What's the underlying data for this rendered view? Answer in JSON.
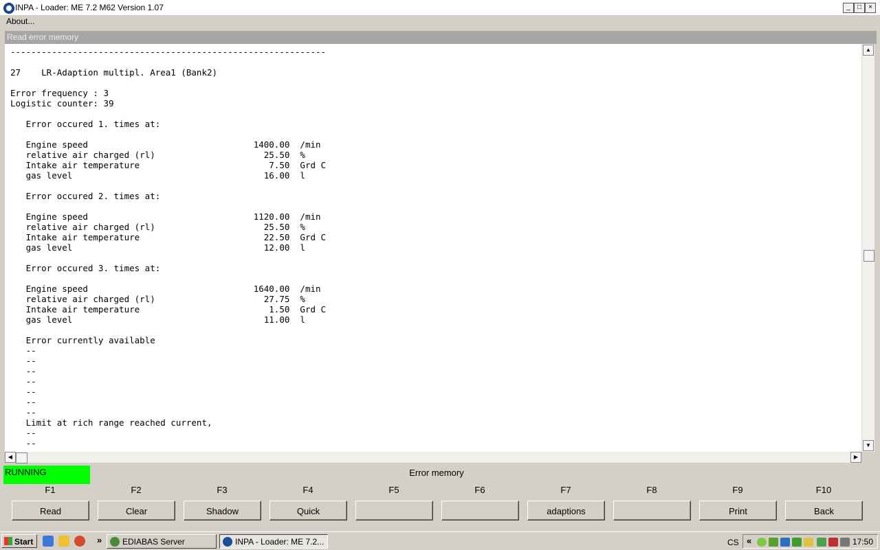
{
  "window": {
    "title": "INPA - Loader: ME 7.2 M62 Version 1.07"
  },
  "menu": {
    "about": "About..."
  },
  "section": {
    "title": "Read error memory"
  },
  "output": {
    "lines": [
      "-------------------------------------------------------------",
      "",
      "27    LR-Adaption multipl. Area1 (Bank2)",
      "",
      "Error frequency : 3",
      "Logistic counter: 39",
      "",
      "   Error occured 1. times at:",
      "",
      "   Engine speed                                1400.00  /min",
      "   relative air charged (rl)                     25.50  %",
      "   Intake air temperature                         7.50  Grd C",
      "   gas level                                     16.00  l",
      "",
      "   Error occured 2. times at:",
      "",
      "   Engine speed                                1120.00  /min",
      "   relative air charged (rl)                     25.50  %",
      "   Intake air temperature                        22.50  Grd C",
      "   gas level                                     12.00  l",
      "",
      "   Error occured 3. times at:",
      "",
      "   Engine speed                                1640.00  /min",
      "   relative air charged (rl)                     27.75  %",
      "   Intake air temperature                         1.50  Grd C",
      "   gas level                                     11.00  l",
      "",
      "   Error currently available",
      "   --",
      "   --",
      "   --",
      "   --",
      "   --",
      "   --",
      "   --",
      "   Limit at rich range reached current,",
      "   --",
      "   --"
    ]
  },
  "status": {
    "text": "RUNNING",
    "color": "#00ff00"
  },
  "screen": {
    "title": "Error memory"
  },
  "fkeys": [
    {
      "key": "F1",
      "label": "Read"
    },
    {
      "key": "F2",
      "label": "Clear"
    },
    {
      "key": "F3",
      "label": "Shadow"
    },
    {
      "key": "F4",
      "label": "Quick"
    },
    {
      "key": "F5",
      "label": ""
    },
    {
      "key": "F6",
      "label": ""
    },
    {
      "key": "F7",
      "label": "adaptions"
    },
    {
      "key": "F8",
      "label": ""
    },
    {
      "key": "F9",
      "label": "Print"
    },
    {
      "key": "F10",
      "label": "Back"
    }
  ],
  "taskbar": {
    "start": "Start",
    "chevron": "»",
    "tasks": [
      {
        "label": "EDIABAS Server",
        "active": false
      },
      {
        "label": "INPA - Loader:  ME 7.2...",
        "active": true
      }
    ],
    "tray_chevron": "«",
    "lang": "CS",
    "clock": "17:50"
  },
  "window_controls": {
    "minimize": "_",
    "maximize": "□",
    "close": "×"
  }
}
